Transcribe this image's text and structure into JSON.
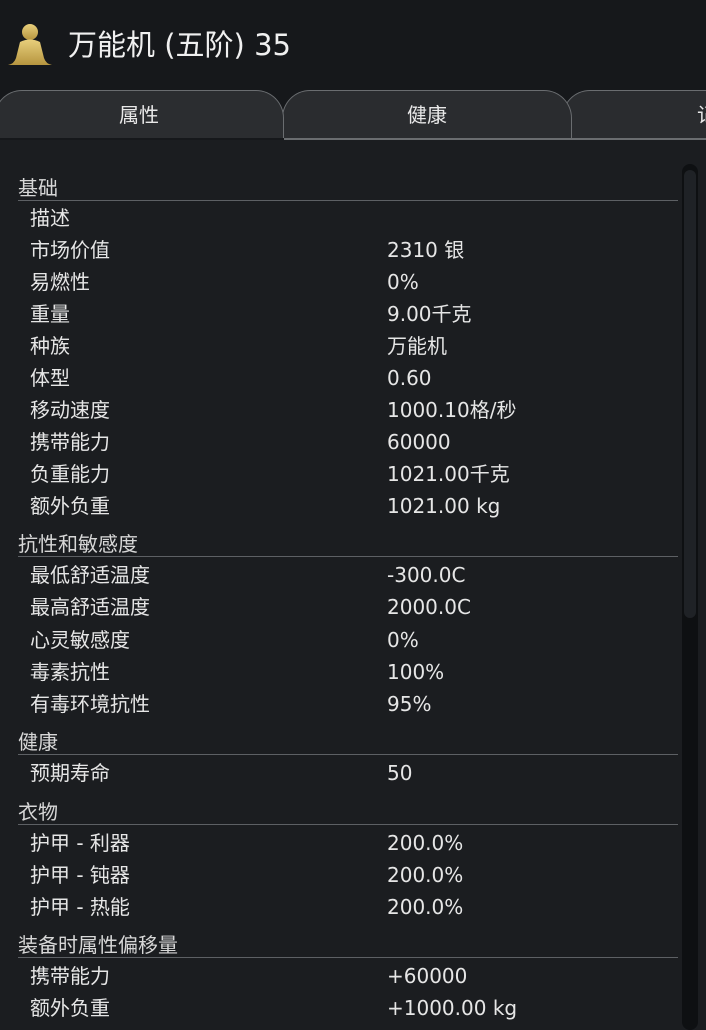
{
  "header": {
    "title": "万能机 (五阶) 35",
    "icon": "pawn-icon",
    "icon_color": "#d7b85e"
  },
  "tabs": [
    {
      "label": "属性",
      "active": true
    },
    {
      "label": "健康",
      "active": false
    },
    {
      "label": "记",
      "active": false
    }
  ],
  "sections": [
    {
      "title": "基础",
      "rows": [
        {
          "label": "描述",
          "value": ""
        },
        {
          "label": "市场价值",
          "value": "2310 银"
        },
        {
          "label": "易燃性",
          "value": "0%"
        },
        {
          "label": "重量",
          "value": "9.00千克"
        },
        {
          "label": "种族",
          "value": "万能机"
        },
        {
          "label": "体型",
          "value": "0.60"
        },
        {
          "label": "移动速度",
          "value": "1000.10格/秒"
        },
        {
          "label": "携带能力",
          "value": "60000"
        },
        {
          "label": "负重能力",
          "value": "1021.00千克"
        },
        {
          "label": "额外负重",
          "value": "1021.00 kg"
        }
      ]
    },
    {
      "title": "抗性和敏感度",
      "rows": [
        {
          "label": "最低舒适温度",
          "value": "-300.0C"
        },
        {
          "label": "最高舒适温度",
          "value": "2000.0C"
        },
        {
          "label": "心灵敏感度",
          "value": "0%"
        },
        {
          "label": "毒素抗性",
          "value": "100%"
        },
        {
          "label": "有毒环境抗性",
          "value": "95%"
        }
      ]
    },
    {
      "title": "健康",
      "rows": [
        {
          "label": "预期寿命",
          "value": "50"
        }
      ]
    },
    {
      "title": "衣物",
      "rows": [
        {
          "label": "护甲 - 利器",
          "value": "200.0%"
        },
        {
          "label": "护甲 - 钝器",
          "value": "200.0%"
        },
        {
          "label": "护甲 - 热能",
          "value": "200.0%"
        }
      ]
    },
    {
      "title": "装备时属性偏移量",
      "rows": [
        {
          "label": "携带能力",
          "value": "+60000"
        },
        {
          "label": "额外负重",
          "value": "+1000.00 kg"
        }
      ]
    }
  ]
}
